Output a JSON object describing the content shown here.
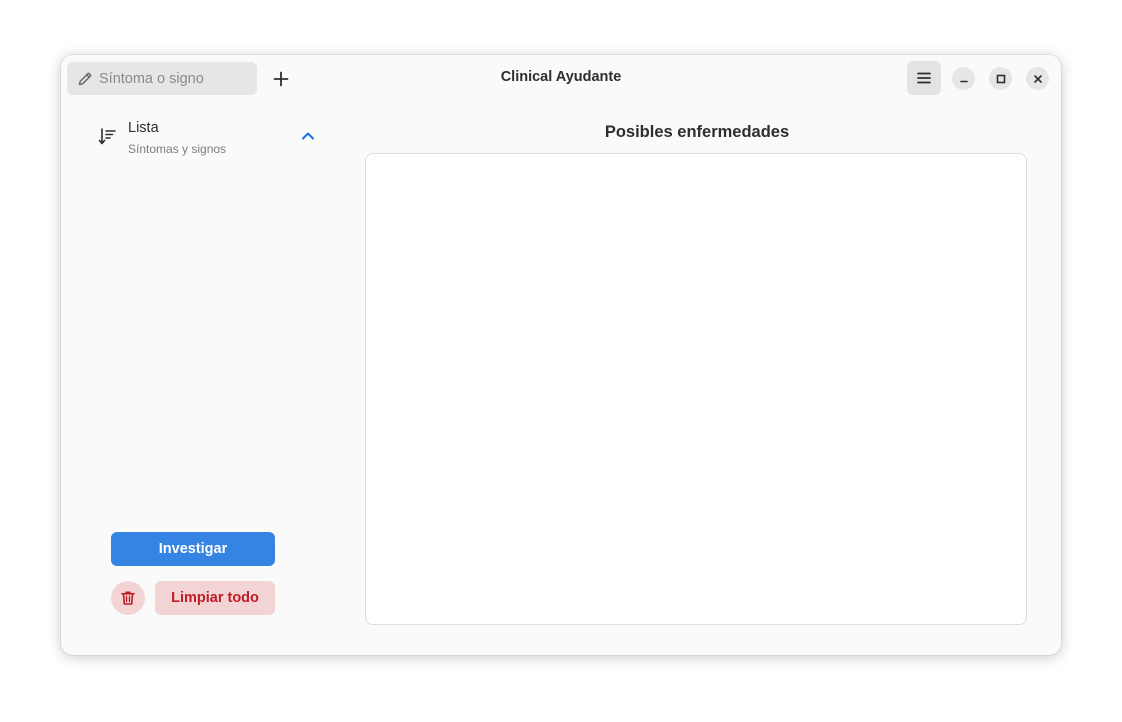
{
  "header": {
    "search_placeholder": "Síntoma o signo",
    "title": "Clinical Ayudante"
  },
  "sidebar": {
    "list_title": "Lista",
    "list_subtitle": "Síntomas y signos",
    "investigate_label": "Investigar",
    "clear_label": "Limpiar todo"
  },
  "main": {
    "heading": "Posibles enfermedades",
    "results": []
  },
  "icons": {
    "search": "pencil-icon",
    "add": "plus-icon",
    "menu": "hamburger-menu-icon",
    "minimize": "minimize-icon",
    "maximize": "maximize-icon",
    "close": "close-icon",
    "sort": "sort-list-icon",
    "collapse": "chevron-up-icon",
    "trash": "trash-icon"
  },
  "colors": {
    "accent": "#3584e4",
    "destructive": "#c01c28",
    "destructive_bg": "#f3d4d4"
  }
}
